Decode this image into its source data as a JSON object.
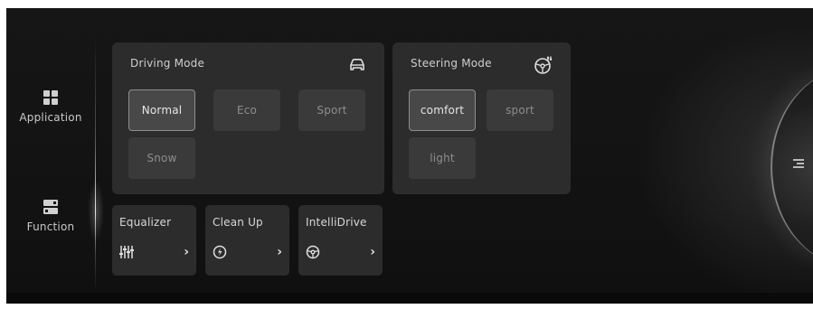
{
  "sidebar": {
    "items": [
      {
        "label": "Application",
        "icon": "grid-icon"
      },
      {
        "label": "Function",
        "icon": "function-panel-icon"
      }
    ]
  },
  "driving_mode": {
    "title": "Driving Mode",
    "icon": "car-icon",
    "options": [
      "Normal",
      "Eco",
      "Sport",
      "Snow"
    ],
    "selected": "Normal"
  },
  "steering_mode": {
    "title": "Steering Mode",
    "icon": "steering-settings-icon",
    "options": [
      "comfort",
      "sport",
      "light"
    ],
    "selected": "comfort"
  },
  "functions": [
    {
      "label": "Equalizer",
      "icon": "equalizer-icon"
    },
    {
      "label": "Clean Up",
      "icon": "clean-up-icon"
    },
    {
      "label": "IntelliDrive",
      "icon": "steering-wheel-icon"
    }
  ],
  "chevron": "›",
  "colors": {
    "background": "#121212",
    "panel": "#2c2c2c",
    "button": "#3a3a3a",
    "active_border": "#8e8e8e"
  }
}
